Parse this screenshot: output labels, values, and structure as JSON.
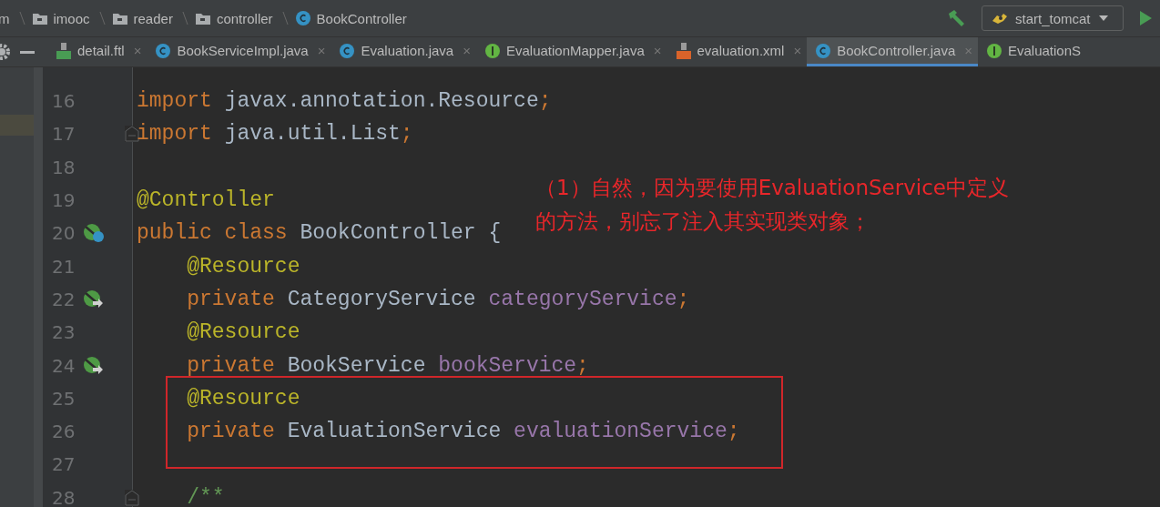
{
  "breadcrumbs": [
    {
      "label": "m",
      "kind": "text"
    },
    {
      "label": "imooc",
      "kind": "folder"
    },
    {
      "label": "reader",
      "kind": "folder"
    },
    {
      "label": "controller",
      "kind": "folder"
    },
    {
      "label": "BookController",
      "kind": "class"
    }
  ],
  "run_config": {
    "label": "start_tomcat"
  },
  "tabs": [
    {
      "label": "detail.ftl",
      "kind": "ftl",
      "selected": false,
      "close": "×"
    },
    {
      "label": "BookServiceImpl.java",
      "kind": "class",
      "selected": false,
      "close": "×"
    },
    {
      "label": "Evaluation.java",
      "kind": "class",
      "selected": false,
      "close": "×"
    },
    {
      "label": "EvaluationMapper.java",
      "kind": "interface",
      "selected": false,
      "close": "×"
    },
    {
      "label": "evaluation.xml",
      "kind": "xml",
      "selected": false,
      "close": "×"
    },
    {
      "label": "BookController.java",
      "kind": "class",
      "selected": true,
      "close": "×"
    },
    {
      "label": "EvaluationS",
      "kind": "interface",
      "selected": false
    }
  ],
  "lines": [
    {
      "number": "16",
      "kind": "plain",
      "fold": false,
      "tokens": [
        {
          "text": "import ",
          "kind": "kw"
        },
        {
          "text": "javax.annotation.Resource",
          "kind": "plain"
        },
        {
          "text": ";",
          "kind": "kw"
        }
      ]
    },
    {
      "number": "17",
      "kind": "plain",
      "fold": true,
      "tokens": [
        {
          "text": "import ",
          "kind": "kw"
        },
        {
          "text": "java.util.List",
          "kind": "plain"
        },
        {
          "text": ";",
          "kind": "kw"
        }
      ]
    },
    {
      "number": "18",
      "kind": "plain",
      "fold": false
    },
    {
      "number": "19",
      "kind": "plain",
      "fold": false,
      "tokens": [
        {
          "text": "@Controller",
          "kind": "ann"
        }
      ]
    },
    {
      "number": "20",
      "kind": "bean-class",
      "fold": false,
      "tokens": [
        {
          "text": "public class ",
          "kind": "kw"
        },
        {
          "text": "BookController {",
          "kind": "plain"
        }
      ]
    },
    {
      "number": "21",
      "kind": "plain",
      "fold": false,
      "tokens": [
        {
          "text": "    @Resource",
          "kind": "ann"
        }
      ]
    },
    {
      "number": "22",
      "kind": "bean-ref",
      "fold": false,
      "tokens": [
        {
          "text": "    private ",
          "kind": "kw"
        },
        {
          "text": "CategoryService ",
          "kind": "plain"
        },
        {
          "text": "categoryService",
          "kind": "field"
        },
        {
          "text": ";",
          "kind": "kw"
        }
      ]
    },
    {
      "number": "23",
      "kind": "plain",
      "fold": false,
      "tokens": [
        {
          "text": "    @Resource",
          "kind": "ann"
        }
      ]
    },
    {
      "number": "24",
      "kind": "bean-ref",
      "fold": false,
      "tokens": [
        {
          "text": "    private ",
          "kind": "kw"
        },
        {
          "text": "BookService ",
          "kind": "plain"
        },
        {
          "text": "bookService",
          "kind": "field"
        },
        {
          "text": ";",
          "kind": "kw"
        }
      ]
    },
    {
      "number": "25",
      "kind": "plain",
      "fold": false,
      "tokens": [
        {
          "text": "    @Resource",
          "kind": "ann"
        }
      ]
    },
    {
      "number": "26",
      "kind": "plain",
      "fold": false,
      "tokens": [
        {
          "text": "    private ",
          "kind": "kw"
        },
        {
          "text": "EvaluationService ",
          "kind": "plain"
        },
        {
          "text": "evaluationService",
          "kind": "field"
        },
        {
          "text": ";",
          "kind": "kw"
        }
      ]
    },
    {
      "number": "27",
      "kind": "plain",
      "fold": false
    },
    {
      "number": "28",
      "kind": "plain",
      "fold": true,
      "tokens": [
        {
          "text": "    /**",
          "kind": "doc"
        }
      ]
    }
  ],
  "note": {
    "lines": [
      "（1）自然，因为要使用EvaluationService中定义",
      "的方法，别忘了注入其实现类对象；"
    ]
  }
}
